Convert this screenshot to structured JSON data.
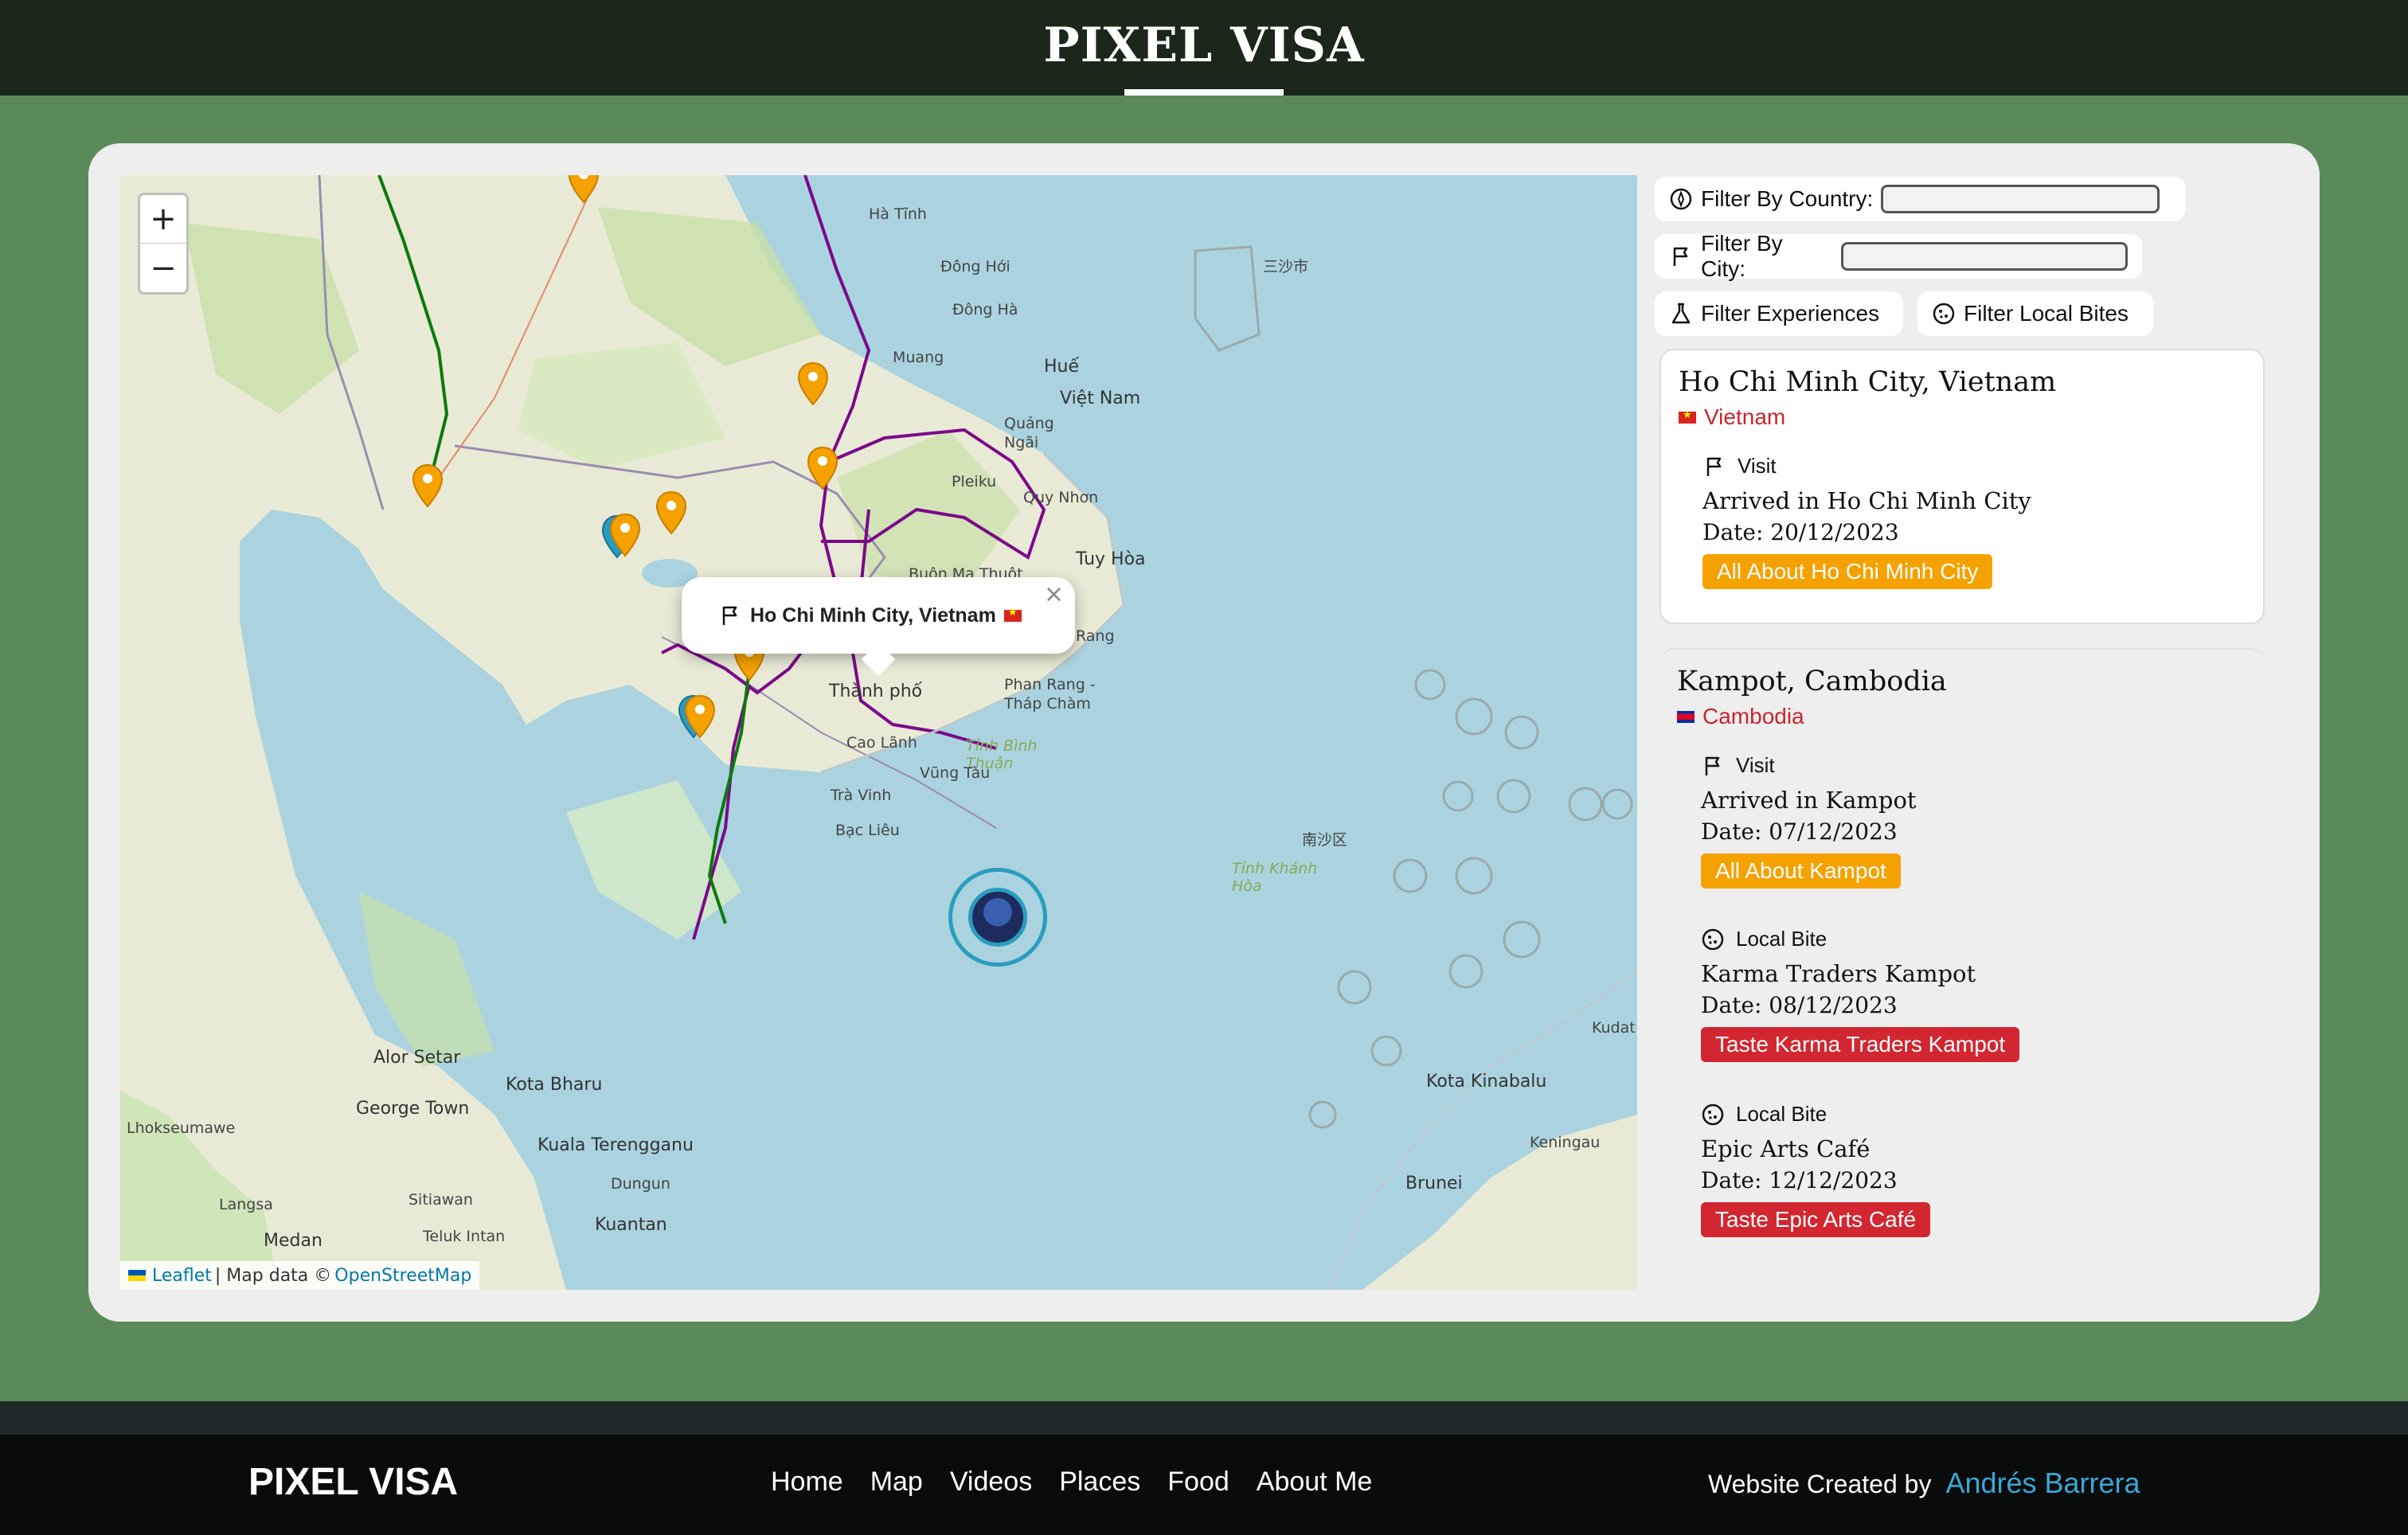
{
  "header": {
    "title": "PIXEL VISA"
  },
  "map": {
    "zoom_in": "+",
    "zoom_out": "−",
    "attribution": {
      "leaflet": "Leaflet",
      "sep": "| Map data ©",
      "osm": "OpenStreetMap"
    },
    "popup": {
      "text": "Ho Chi Minh City, Vietnam"
    },
    "labels": {
      "danang": "Đông Hới",
      "hue": "Huế",
      "viet_nam": "Việt Nam",
      "quang_ngai": "Quảng Ngãi",
      "pleiku": "Pleiku",
      "quy_nhon": "Quy Nhơn",
      "tuy_hoa": "Tuy Hòa",
      "buon_ma_thuot": "Buôn Ma Thuột",
      "phan_rang": "Phan Rang - Tháp Chàm",
      "binh_thuan": "Tỉnh Bình Thuận",
      "cao_lanh": "Cao Lãnh",
      "tra_vinh": "Trà Vinh",
      "bac_lieu": "Bạc Liêu",
      "vung_tau": "Vũng Tàu",
      "thanh_pho": "Thành phố",
      "alor_setar": "Alor Setar",
      "george_town": "George Town",
      "kota_bharu": "Kota Bharu",
      "kuala_terengganu": "Kuala Terengganu",
      "dungun": "Dungun",
      "kuantan": "Kuantan",
      "medan": "Medan",
      "langsa": "Langsa",
      "lhokseumawe": "Lhokseumawe",
      "sitiawan": "Sitiawan",
      "teluk_intan": "Teluk Intan",
      "kota_kinabalu": "Kota Kinabalu",
      "keningau": "Keningau",
      "brunei": "Brunei",
      "kudat": "Kudat",
      "truong_sa": "Tỉnh Khánh Hòa",
      "nansha": "南沙区",
      "xisha": "三沙市",
      "ha_tinh": "Hà Tĩnh",
      "dong_ha": "Đông Hà",
      "muang": "Muang",
      "rang": "Rang"
    }
  },
  "filters": {
    "country_label": "Filter By Country:",
    "city_label": "Filter By City:",
    "experiences": "Filter Experiences",
    "local_bites": "Filter Local Bites"
  },
  "entries": [
    {
      "title": "Ho Chi Minh City, Vietnam",
      "country": "Vietnam",
      "items": [
        {
          "kind": "Visit",
          "desc": "Arrived in Ho Chi Minh City",
          "date": "Date: 20/12/2023",
          "tag": "All About Ho Chi Minh City"
        }
      ]
    },
    {
      "title": "Kampot, Cambodia",
      "country": "Cambodia",
      "items": [
        {
          "kind": "Visit",
          "desc": "Arrived in Kampot",
          "date": "Date: 07/12/2023",
          "tag": "All About Kampot"
        },
        {
          "kind": "Local Bite",
          "desc": "Karma Traders Kampot",
          "date": "Date: 08/12/2023",
          "tag": "Taste Karma Traders Kampot"
        },
        {
          "kind": "Local Bite",
          "desc": "Epic Arts Café",
          "date": "Date: 12/12/2023",
          "tag": "Taste Epic Arts Café"
        }
      ]
    }
  ],
  "footer": {
    "brand": "PIXEL VISA",
    "nav": [
      "Home",
      "Map",
      "Videos",
      "Places",
      "Food",
      "About Me"
    ],
    "credit": "Website Created by",
    "author": "Andrés Barrera"
  },
  "colors": {
    "header": "#1b271b",
    "page": "#5b8a5a",
    "orange": "#f5a100",
    "red": "#d22630",
    "link": "#3aa7d6"
  }
}
